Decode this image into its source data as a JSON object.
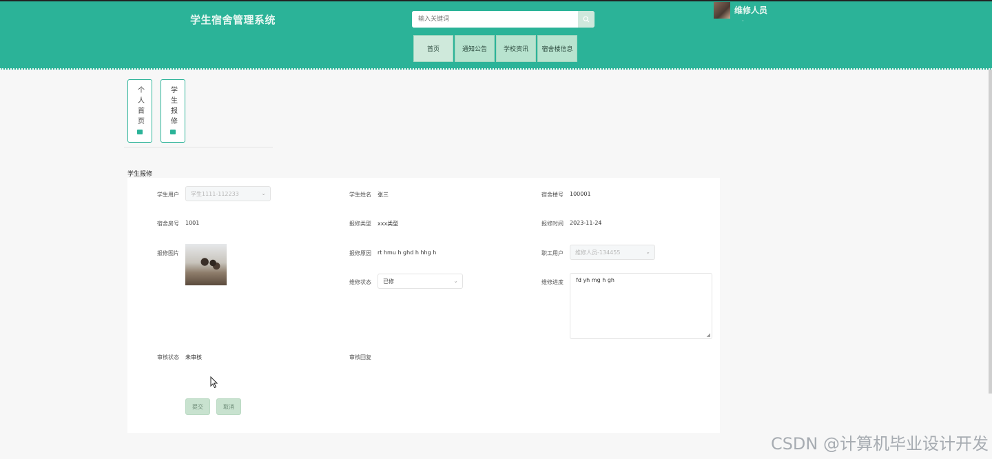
{
  "header": {
    "app_title": "学生宿舍管理系统",
    "search_placeholder": "输入关键词",
    "user_role": "维修人员",
    "user_sub": "·"
  },
  "nav": {
    "items": [
      "首页",
      "通知公告",
      "学校资讯",
      "宿舍楼信息"
    ]
  },
  "sidebar": {
    "tabs": [
      {
        "label": "个人首页"
      },
      {
        "label": "学生报修"
      }
    ]
  },
  "page": {
    "section_title": "学生报修"
  },
  "form": {
    "student_account_label": "学生用户",
    "student_account_value": "学生1111-112233",
    "student_name_label": "学生姓名",
    "student_name_value": "张三",
    "building_label": "宿舍楼号",
    "building_value": "100001",
    "room_label": "宿舍房号",
    "room_value": "1001",
    "repair_type_label": "报修类型",
    "repair_type_value": "xxx类型",
    "repair_time_label": "报修时间",
    "repair_time_value": "2023-11-24",
    "repair_photo_label": "报修图片",
    "repair_reason_label": "报修原因",
    "repair_reason_value": "rt hmu h ghd h hhg h",
    "staff_account_label": "职工用户",
    "staff_account_value": "维修人员-134455",
    "repair_status_label": "维修状态",
    "repair_status_value": "已修",
    "repair_progress_label": "维修进度",
    "repair_progress_value": "fd yh mg h gh",
    "review_status_label": "审核状态",
    "review_status_value": "未审核",
    "review_reply_label": "审核回复",
    "submit_label": "提交",
    "cancel_label": "取消"
  },
  "watermark": "CSDN @计算机毕业设计开发"
}
